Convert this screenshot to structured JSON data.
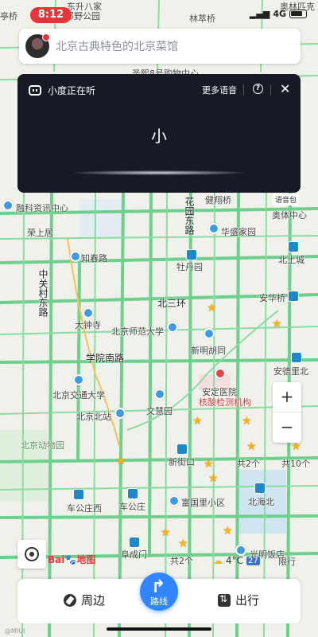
{
  "status_bar": {
    "time": "8:12",
    "network": "4G"
  },
  "search": {
    "placeholder": "北京古典特色的北京菜馆"
  },
  "voice_panel": {
    "title": "小度正在听",
    "more_voice": "更多语音",
    "help_icon": "?",
    "close_icon": "✕",
    "recognized_text": "小"
  },
  "voice_pack_label": "语音包",
  "map": {
    "labels": [
      "亭桥",
      "邮野公园",
      "东升八家",
      "林萃桥",
      "奥林匹克",
      "圣熙8号购物中心",
      "融科资讯中心",
      "花园东路",
      "健翔桥",
      "奥体中心",
      "荣上居",
      "华盛家园",
      "知春路",
      "牡丹园",
      "北土城",
      "中关村东路",
      "北三环",
      "安华桥",
      "大钟寺",
      "北京师范大学",
      "新明胡同",
      "学院南路",
      "安德里北",
      "北京交通大学",
      "安定医院",
      "核酸检测机构",
      "北京北站",
      "文慧园",
      "北京动物园",
      "新街口",
      "共2个",
      "共10个",
      "车公庄西",
      "车公庄",
      "富国里小区",
      "北海北",
      "阜成门",
      "共2个",
      "光明饭店",
      "限行"
    ]
  },
  "zoom": {
    "in": "+",
    "out": "−"
  },
  "logo": {
    "text": "Bai",
    "paw": "🐾",
    "suffix": "地图"
  },
  "weather": {
    "temp": "4°C",
    "aqi": "27"
  },
  "bottom_bar": {
    "nearby": "周边",
    "route": "路线",
    "travel": "出行"
  },
  "watermark": "@MIUI"
}
